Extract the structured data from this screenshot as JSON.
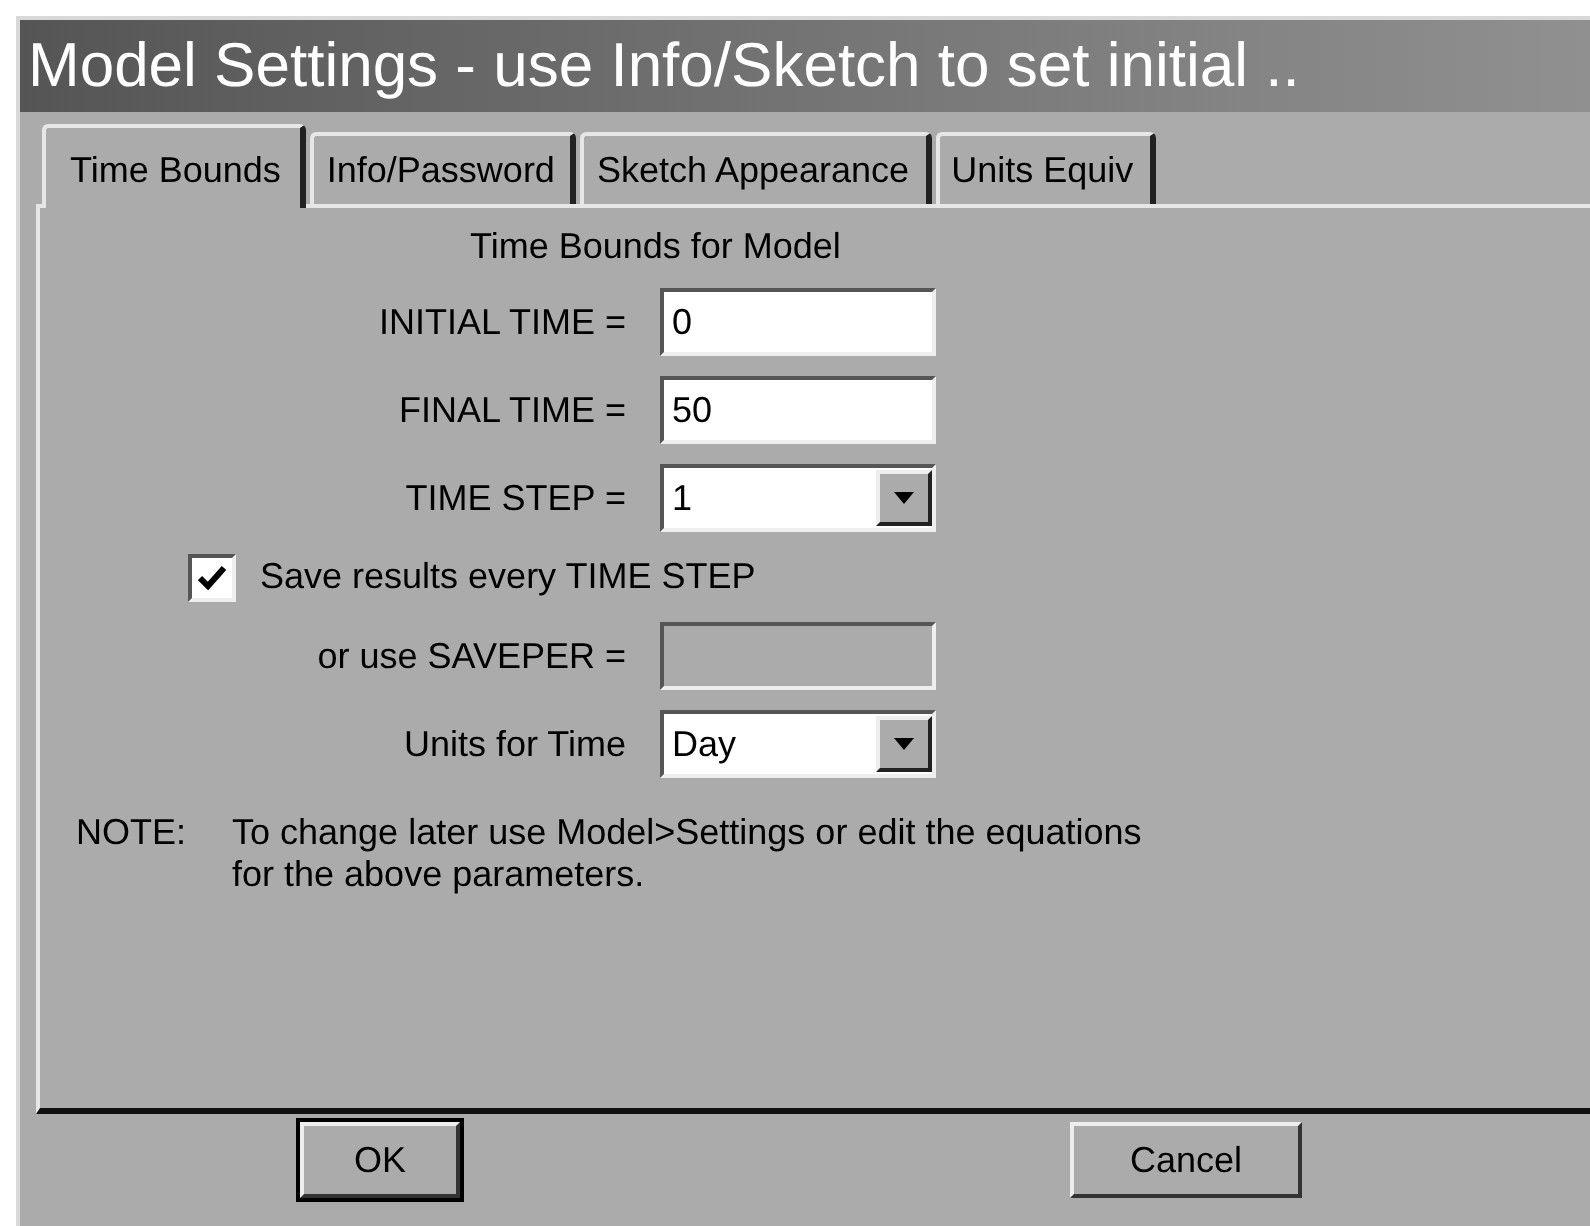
{
  "window": {
    "title": "Model Settings - use Info/Sketch to set initial .."
  },
  "tabs": [
    {
      "label": "Time Bounds",
      "selected": true
    },
    {
      "label": "Info/Password",
      "selected": false
    },
    {
      "label": "Sketch Appearance",
      "selected": false
    },
    {
      "label": "Units Equiv",
      "selected": false
    }
  ],
  "panel": {
    "heading": "Time Bounds for Model",
    "fields": [
      {
        "kind": "text",
        "label": "INITIAL TIME =",
        "value": "0",
        "disabled": false
      },
      {
        "kind": "text",
        "label": "FINAL TIME =",
        "value": "50",
        "disabled": false
      },
      {
        "kind": "combo",
        "label": "TIME STEP =",
        "value": "1"
      },
      {
        "kind": "checkbox",
        "label": "Save results every TIME STEP",
        "checked": true
      },
      {
        "kind": "text",
        "label": "or use SAVEPER =",
        "disabled": true
      },
      {
        "kind": "combo",
        "label": "Units for Time",
        "value": "Day"
      }
    ],
    "note": {
      "label": "NOTE:",
      "lines": [
        "To change later use Model>Settings or edit the equations",
        "for the above parameters."
      ]
    }
  },
  "buttons": [
    {
      "label": "OK",
      "default": true
    },
    {
      "label": "Cancel",
      "default": false
    }
  ]
}
